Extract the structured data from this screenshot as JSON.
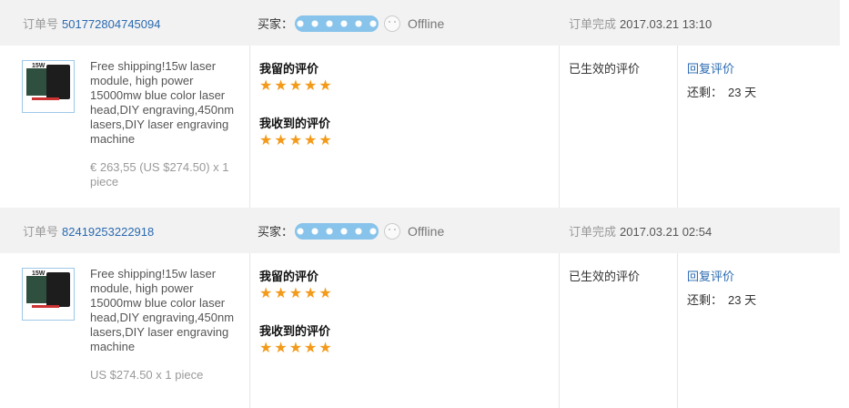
{
  "labels": {
    "order_no": "订单号",
    "buyer": "买家：",
    "completed": "订单完成",
    "my_review": "我留的评价",
    "received_review": "我收到的评价",
    "effective": "已生效的评价",
    "reply": "回复评价",
    "remaining": "还剩："
  },
  "orders": [
    {
      "order_id": "501772804745094",
      "buyer_status": "Offline",
      "completed_time": "2017.03.21 13:10",
      "product_title": "Free shipping!15w laser module, high power 15000mw blue color laser head,DIY engraving,450nm lasers,DIY laser engraving machine",
      "price": "€ 263,55 (US $274.50) x 1 piece",
      "my_rating": 5,
      "received_rating": 5,
      "days_left": "23 天"
    },
    {
      "order_id": "82419253222918",
      "buyer_status": "Offline",
      "completed_time": "2017.03.21 02:54",
      "product_title": "Free shipping!15w laser module, high power 15000mw blue color laser head,DIY engraving,450nm lasers,DIY laser engraving machine",
      "price": "US $274.50 x 1 piece",
      "my_rating": 5,
      "received_rating": 5,
      "days_left": "23 天"
    }
  ],
  "thumb_text": "15W",
  "colors": {
    "link": "#2a6ab0",
    "star": "#f39a1a",
    "header_bg": "#f2f2f2"
  }
}
